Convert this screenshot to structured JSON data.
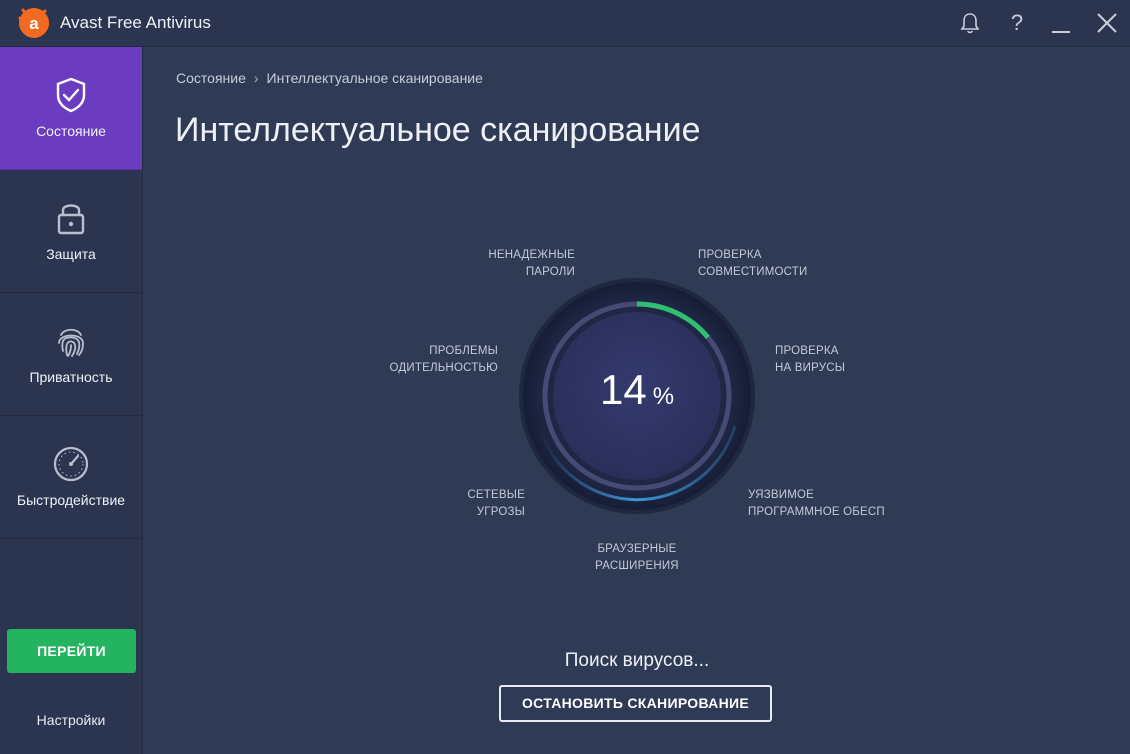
{
  "app": {
    "title": "Avast Free Antivirus",
    "logo_letter": "a",
    "brand_color": "#f26a21"
  },
  "titlebar": {
    "icons": [
      "bell-icon",
      "help-icon",
      "minimize-icon",
      "close-icon"
    ],
    "help_glyph": "?"
  },
  "sidebar": {
    "items": [
      {
        "label": "Состояние",
        "icon": "shield-check-icon",
        "active": true
      },
      {
        "label": "Защита",
        "icon": "lock-icon",
        "active": false
      },
      {
        "label": "Приватность",
        "icon": "fingerprint-icon",
        "active": false
      },
      {
        "label": "Быстродействие",
        "icon": "speedometer-icon",
        "active": false
      }
    ],
    "go_button": "ПЕРЕЙТИ",
    "settings": "Настройки",
    "active_color": "#6b3cbf",
    "go_color": "#24b35f"
  },
  "main": {
    "breadcrumb": {
      "root": "Состояние",
      "separator": "›",
      "current": "Интеллектуальное сканирование"
    },
    "title": "Интеллектуальное сканирование",
    "scan": {
      "progress_value": "14",
      "progress_unit": "%",
      "progress_fraction": 0.14,
      "stages": {
        "passwords": [
          "НЕНАДЕЖНЫЕ",
          "ПАРОЛИ"
        ],
        "compat": [
          "ПРОВЕРКА",
          "СОВМЕСТИМОСТИ"
        ],
        "viruses": [
          "ПРОВЕРКА",
          "НА ВИРУСЫ"
        ],
        "software": [
          "УЯЗВИМОЕ",
          "ПРОГРАММНОЕ ОБЕСП"
        ],
        "browser": [
          "БРАУЗЕРНЫЕ",
          "РАСШИРЕНИЯ"
        ],
        "network": [
          "СЕТЕВЫЕ",
          "УГРОЗЫ"
        ],
        "performance": [
          "ПРОБЛЕМЫ",
          "ОДИТЕЛЬНОСТЬЮ"
        ]
      },
      "status": "Поиск вирусов...",
      "stop_button": "ОСТАНОВИТЬ СКАНИРОВАНИЕ",
      "progress_color": "#2fbf71",
      "glow_color": "#3fa3e6"
    }
  }
}
